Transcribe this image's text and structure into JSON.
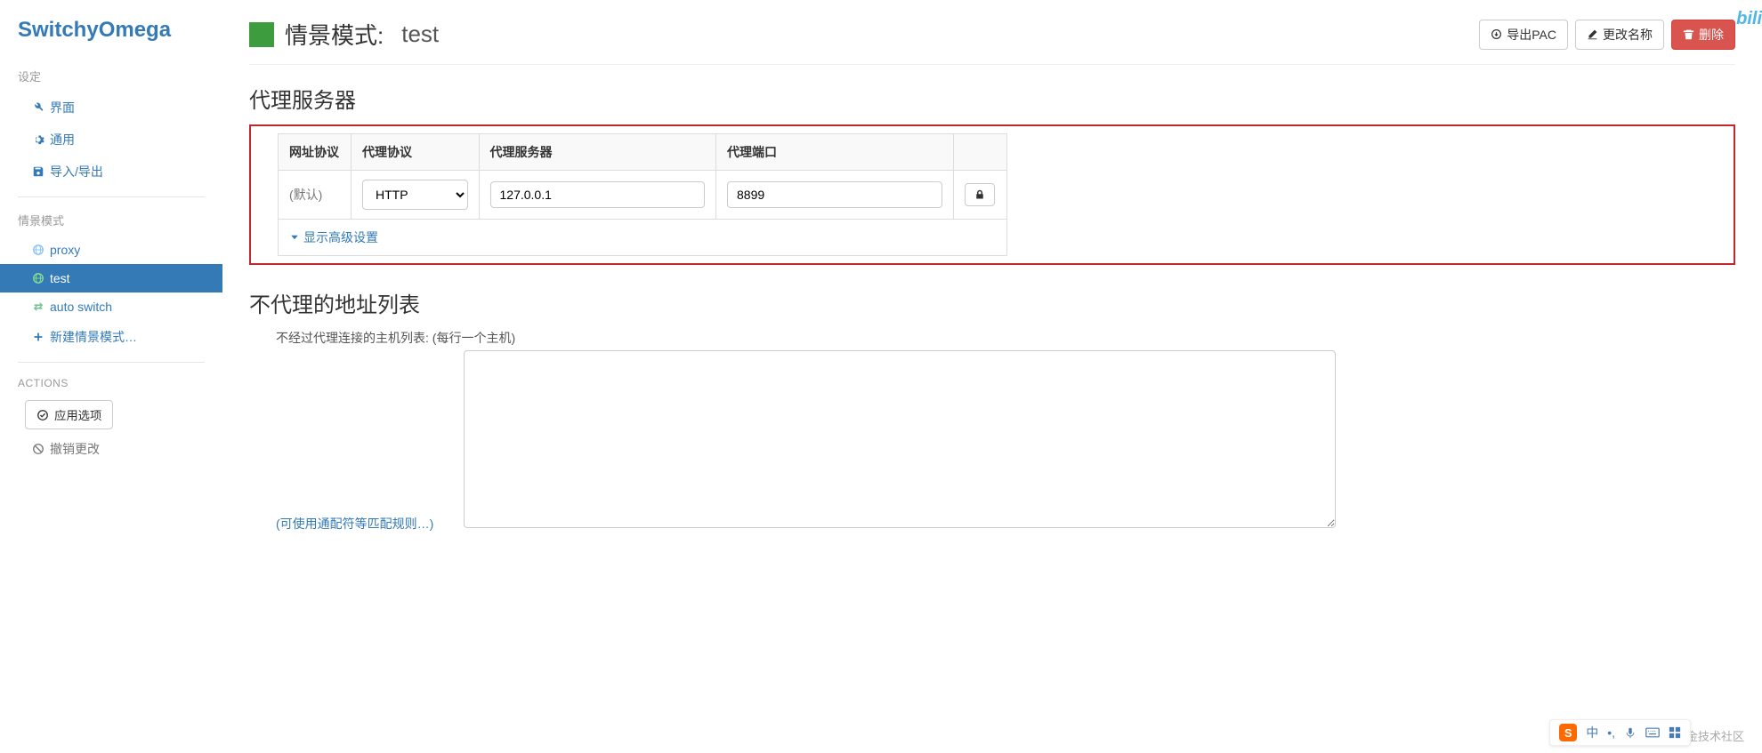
{
  "brand": "SwitchyOmega",
  "sidebar": {
    "settings_header": "设定",
    "settings": [
      {
        "icon": "wrench",
        "label": "界面"
      },
      {
        "icon": "gear",
        "label": "通用"
      },
      {
        "icon": "save",
        "label": "导入/导出"
      }
    ],
    "profiles_header": "情景模式",
    "profiles": [
      {
        "icon": "globe",
        "label": "proxy",
        "color": "#80bfff",
        "active": false
      },
      {
        "icon": "globe",
        "label": "test",
        "color": "#8de28d",
        "active": true
      },
      {
        "icon": "transfer",
        "label": "auto switch",
        "color": "#7ac29a",
        "active": false
      },
      {
        "icon": "plus",
        "label": "新建情景模式…",
        "color": "#337ab7",
        "active": false
      }
    ],
    "actions_header": "ACTIONS",
    "apply_label": "应用选项",
    "discard_label": "撤销更改"
  },
  "header": {
    "title_prefix": "情景模式:",
    "profile_name": "test",
    "profile_color": "#3d9c3d",
    "export_pac": "导出PAC",
    "rename": "更改名称",
    "delete": "删除"
  },
  "proxy_section": {
    "title": "代理服务器",
    "columns": {
      "scheme": "网址协议",
      "protocol": "代理协议",
      "server": "代理服务器",
      "port": "代理端口"
    },
    "row": {
      "scheme_label": "(默认)",
      "protocol_value": "HTTP",
      "server_value": "127.0.0.1",
      "port_value": "8899"
    },
    "advanced_label": "显示高级设置"
  },
  "bypass_section": {
    "title": "不代理的地址列表",
    "desc": "不经过代理连接的主机列表: (每行一个主机)",
    "link": "(可使用通配符等匹配规则…)",
    "value": ""
  },
  "watermark": {
    "top": "bili",
    "bottom": "@稀土掘金技术社区"
  },
  "ime": {
    "brand": "S",
    "items": [
      "中",
      "•,",
      "🎤",
      "⌨",
      "⊞"
    ]
  }
}
